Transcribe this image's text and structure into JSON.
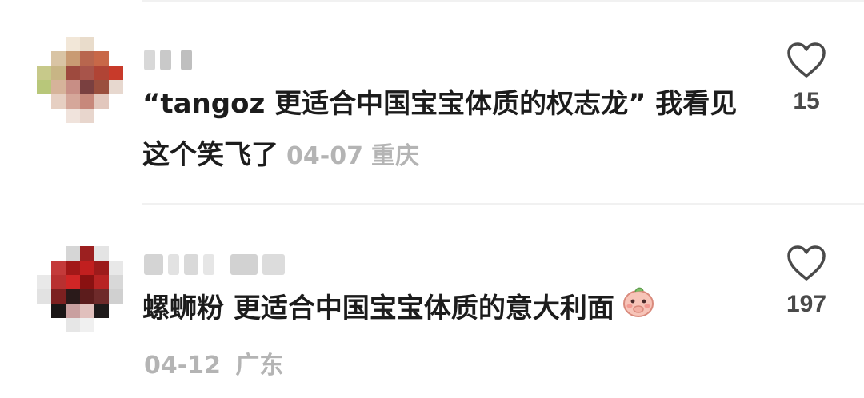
{
  "comments": [
    {
      "text": "“tangoz 更适合中国宝宝体质的权志龙” 我看见这个笑飞了",
      "date": "04-07",
      "location": "重庆",
      "likes": "15"
    },
    {
      "text": "螺蛳粉 更适合中国宝宝体质的意大利面",
      "date": "04-12",
      "location": "广东",
      "likes": "197",
      "emoji": "shy-peach-emoji"
    }
  ],
  "icons": {
    "like": "heart-outline-icon"
  },
  "colors": {
    "text": "#1c1c1c",
    "meta": "#b4b4b4",
    "like_count": "#4a4a4a"
  }
}
